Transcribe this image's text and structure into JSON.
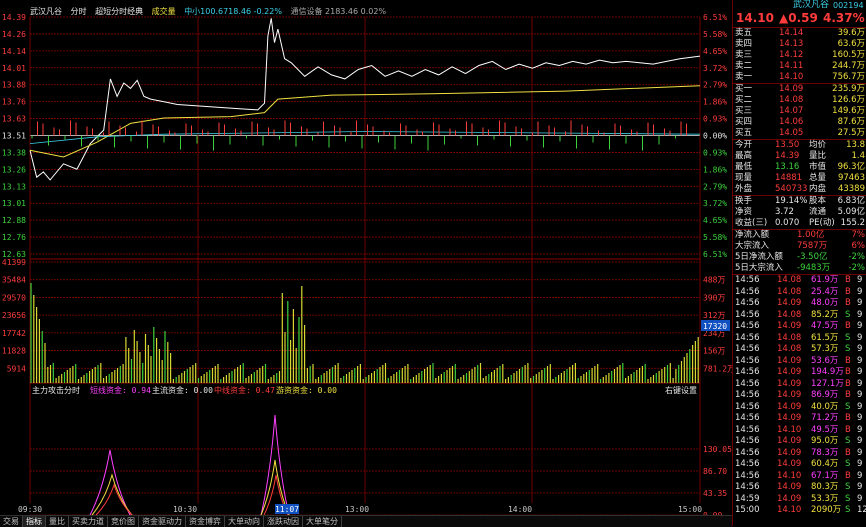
{
  "header": {
    "stock_name": "武汉凡谷",
    "mode": "分时",
    "ref": "超短分时经典",
    "indicator": "成交量",
    "index_info": "中小100.6718.46 -0.22%",
    "sector_info": "通信设备 2183.46 0.02%"
  },
  "side_header": {
    "title": "武汉凡谷",
    "code": "002194",
    "price": "14.10",
    "change": "▲0.59",
    "pct": "4.37%"
  },
  "price_axis": {
    "left_labels": [
      "14.39",
      "14.26",
      "14.14",
      "14.01",
      "13.88",
      "13.76",
      "13.63",
      "13.51",
      "13.38",
      "13.26",
      "13.13",
      "13.01",
      "12.88",
      "12.76",
      "12.63"
    ],
    "right_labels": [
      "6.51%",
      "5.58%",
      "4.65%",
      "3.72%",
      "2.79%",
      "1.86%",
      "0.93%",
      "0.00%",
      "0.93%",
      "1.86%",
      "2.79%",
      "3.72%",
      "4.65%",
      "5.58%",
      "6.51%"
    ],
    "reference_price": "13.51"
  },
  "volume_axis": {
    "left_labels": [
      "41399",
      "35484",
      "29570",
      "23656",
      "17742",
      "11828",
      "5914"
    ],
    "right_labels": [
      "488万",
      "390万",
      "312万",
      "234万",
      "156万",
      "781.2万"
    ],
    "current_volume": "17320"
  },
  "indicator_panel": {
    "title": "主力攻击分时",
    "items": [
      {
        "label": "短线资金: 0.94",
        "color": "#ff40ff"
      },
      {
        "label": "主流资金: 0.00",
        "color": "#e6e6e6"
      },
      {
        "label": "中线资金: 0.47",
        "color": "#ff3c3c"
      },
      {
        "label": "游资资金: 0.00",
        "color": "#f0e040"
      }
    ],
    "settings_label": "右键设置",
    "right_labels": [
      "130.05",
      "86.70",
      "43.35",
      "0.00"
    ]
  },
  "time_axis": [
    "09:30",
    "10:30",
    "11:07",
    "13:00",
    "14:00",
    "15:00"
  ],
  "bottom_tabs": [
    "交易",
    "指标",
    "量比",
    "买卖力道",
    "竞价图",
    "资金驱动力",
    "资金博弈",
    "大单动向",
    "涨跌动因",
    "大单笔分"
  ],
  "order_book": {
    "sells": [
      {
        "label": "卖五",
        "price": "14.14",
        "vol": "39.6万"
      },
      {
        "label": "卖四",
        "price": "14.13",
        "vol": "63.6万"
      },
      {
        "label": "卖三",
        "price": "14.12",
        "vol": "160.5万"
      },
      {
        "label": "卖二",
        "price": "14.11",
        "vol": "244.7万"
      },
      {
        "label": "卖一",
        "price": "14.10",
        "vol": "756.7万"
      }
    ],
    "buys": [
      {
        "label": "买一",
        "price": "14.09",
        "vol": "235.9万"
      },
      {
        "label": "买二",
        "price": "14.08",
        "vol": "126.6万"
      },
      {
        "label": "买三",
        "price": "14.07",
        "vol": "149.6万"
      },
      {
        "label": "买四",
        "price": "14.06",
        "vol": "87.6万"
      },
      {
        "label": "买五",
        "price": "14.05",
        "vol": "27.5万"
      }
    ]
  },
  "stats": [
    [
      "今开",
      "13.50",
      "均价",
      "13.8"
    ],
    [
      "最高",
      "14.39",
      "量比",
      "1.4"
    ],
    [
      "最低",
      "13.16",
      "市值",
      "96.3亿"
    ],
    [
      "现量",
      "14881",
      "总量",
      "97463"
    ],
    [
      "外盘",
      "540733",
      "内盘",
      "43389"
    ]
  ],
  "stats2": [
    [
      "换手",
      "19.14%",
      "股本",
      "6.83亿"
    ],
    [
      "净资",
      "3.72",
      "流通",
      "5.09亿"
    ],
    [
      "收益(三)",
      "0.070",
      "PE(动)",
      "155.2"
    ]
  ],
  "flows": [
    {
      "label": "净流入额",
      "value": "1.00亿",
      "pct": "7%"
    },
    {
      "label": "大宗流入",
      "value": "7587万",
      "pct": "6%"
    },
    {
      "label": "5日净流入额",
      "value": "-3.50亿",
      "pct": "-2%"
    },
    {
      "label": "5日大宗流入",
      "value": "-9483万",
      "pct": "-2%"
    }
  ],
  "ticks": [
    [
      "14:56",
      "14.08",
      "61.9万",
      "B",
      "9"
    ],
    [
      "14:56",
      "14.08",
      "25.4万",
      "B",
      "9"
    ],
    [
      "14:56",
      "14.09",
      "48.0万",
      "B",
      "9"
    ],
    [
      "14:56",
      "14.08",
      "85.2万",
      "S",
      "9"
    ],
    [
      "14:56",
      "14.09",
      "47.5万",
      "B",
      "9"
    ],
    [
      "14:56",
      "14.08",
      "61.5万",
      "S",
      "9"
    ],
    [
      "14:56",
      "14.08",
      "57.3万",
      "S",
      "9"
    ],
    [
      "14:56",
      "14.09",
      "53.6万",
      "B",
      "9"
    ],
    [
      "14:56",
      "14.09",
      "194.9万",
      "B",
      "9"
    ],
    [
      "14:56",
      "14.09",
      "127.1万",
      "B",
      "9"
    ],
    [
      "14:56",
      "14.09",
      "86.9万",
      "B",
      "9"
    ],
    [
      "14:56",
      "14.09",
      "40.0万",
      "S",
      "9"
    ],
    [
      "14:56",
      "14.09",
      "71.2万",
      "B",
      "9"
    ],
    [
      "14:56",
      "14.10",
      "49.5万",
      "B",
      "9"
    ],
    [
      "14:56",
      "14.09",
      "95.0万",
      "S",
      "9"
    ],
    [
      "14:56",
      "14.09",
      "78.3万",
      "B",
      "9"
    ],
    [
      "14:56",
      "14.09",
      "60.4万",
      "S",
      "9"
    ],
    [
      "14:56",
      "14.10",
      "67.1万",
      "B",
      "9"
    ],
    [
      "14:56",
      "14.09",
      "80.3万",
      "S",
      "9"
    ],
    [
      "14:59",
      "14.09",
      "53.3万",
      "S",
      "9"
    ],
    [
      "15:00",
      "14.10",
      "2090万",
      "S",
      "12"
    ]
  ],
  "colors": {
    "price_line": "#ffffff",
    "avg_line": "#f0e040",
    "grid_red": "#8a0000",
    "up": "#ff3c3c",
    "down": "#3cd23c"
  }
}
